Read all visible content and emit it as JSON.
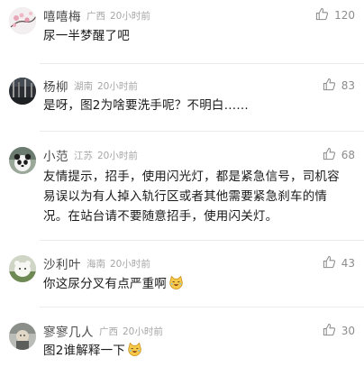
{
  "comments": [
    {
      "user": "嘻嘻梅",
      "location": "广西",
      "time": "20小时前",
      "likes": "120",
      "text": "尿一半梦醒了吧",
      "emoji": ""
    },
    {
      "user": "杨柳",
      "location": "湖南",
      "time": "20小时前",
      "likes": "83",
      "text": "是呀，图2为啥要洗手呢？不明白……",
      "emoji": ""
    },
    {
      "user": "小范",
      "location": "江苏",
      "time": "20小时前",
      "likes": "68",
      "text": "友情提示，招手，使用闪光灯，都是紧急信号，司机容易误以为有人掉入轨行区或者其他需要紧急刹车的情况。在站台请不要随意招手，使用闪关灯。",
      "emoji": ""
    },
    {
      "user": "沙利叶",
      "location": "海南",
      "time": "20小时前",
      "likes": "43",
      "text": "你这尿分叉有点严重啊",
      "emoji": "laughing-cat"
    },
    {
      "user": "寥寥几人",
      "location": "广西",
      "time": "20小时前",
      "likes": "30",
      "text": "图2谁解释一下",
      "emoji": "laughing-cat"
    }
  ],
  "icons": {
    "like": "thumbs-up-icon",
    "emoji": "laughing-cat-emoji-icon"
  },
  "colors": {
    "username": "#4a4a4a",
    "meta": "#a6a6a6",
    "text": "#1a1a1a",
    "like": "#8c8c8c"
  }
}
